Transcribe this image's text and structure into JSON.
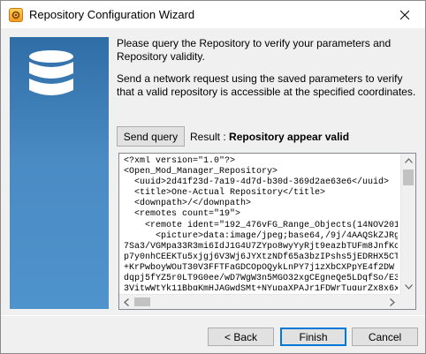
{
  "window": {
    "title": "Repository Configuration Wizard"
  },
  "intro": {
    "line1": "Please query the Repository to verify your parameters and Repository validity.",
    "line2": "Send a network request using the saved parameters to verify that a valid repository is accessible at the specified coordinates."
  },
  "query": {
    "send_label": "Send query",
    "result_prefix": "Result :",
    "result_value": "Repository appear valid"
  },
  "xml_content": "<?xml version=\"1.0\"?>\n<Open_Mod_Manager_Repository>\n  <uuid>2d41f23d-7a19-4d7d-b30d-369d2ae63e6</uuid>\n  <title>One-Actual Repository</title>\n  <downpath>/</downpath>\n  <remotes count=\"19\">\n    <remote ident=\"192_476vFG_Range_Objects(14NOV201\n      <picture>data:image/jpeg;base64,/9j/4AAQSkZJRg\n7Sa3/VGMpa33R3mi6IdJ1G4U7ZYpo8wyYyRjt9eazbTUFm8JnfKc\np7y0nhCEEKTu5xjgj6V3Wj6JYXtzNDf65a3bzIPshs5jEDRHX5CT\n+KrPwboyWOuT30V3FFTFaGDCOpOQykLnPY7j1zXbCXPpYE4f2DW\ndqpj5fYZ5r0LT9G0ee/wD7WgW3n5MGO32xgCEgneQe5LDqfSo/E3\n3VitwWtYk11BbgKmHJAGwdSMt+NYupaXPAJr1FDWrTuqurZx8x6x",
  "buttons": {
    "back": "< Back",
    "finish": "Finish",
    "cancel": "Cancel"
  }
}
